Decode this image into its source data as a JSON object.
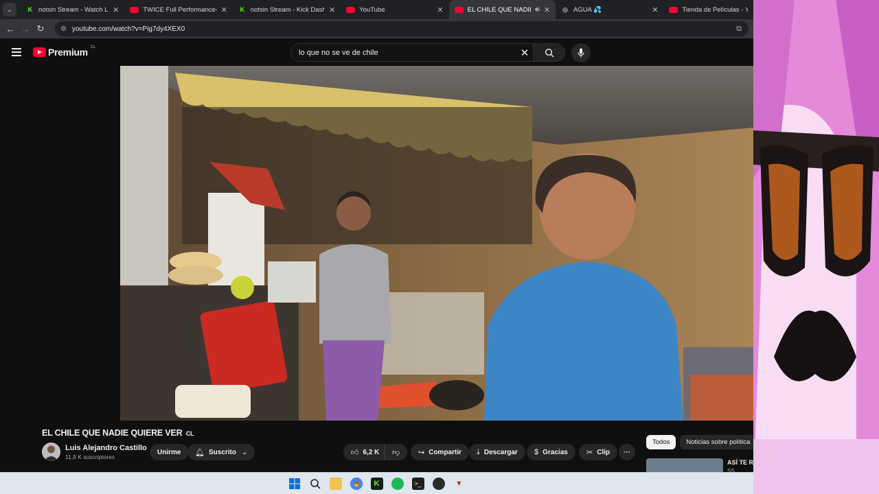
{
  "browser": {
    "tabs": [
      {
        "title": "notsin Stream - Watch Live on Kick",
        "icon": "kick-icon",
        "active": false
      },
      {
        "title": "TWICE Full Performance-Lollapalooza",
        "icon": "youtube-icon",
        "active": false
      },
      {
        "title": "notsin Stream - Kick Dashboard",
        "icon": "kick-icon",
        "active": false
      },
      {
        "title": "YouTube",
        "icon": "youtube-icon",
        "active": false
      },
      {
        "title": "EL CHILE QUE NADIE QUIERE VER",
        "icon": "youtube-icon",
        "active": true,
        "audio": true
      },
      {
        "title": "AGUA 💦",
        "icon": "web-icon",
        "active": false
      },
      {
        "title": "Tienda de Películas - YouTube",
        "icon": "youtube-icon",
        "active": false
      }
    ],
    "url": "youtube.com/watch?v=Pig7dy4XEX0"
  },
  "youtube": {
    "logo_text": "Premium",
    "country_code": "CL",
    "search_query": "lo que no se ve de chile"
  },
  "video": {
    "title": "EL CHILE QUE NADIE QUIERE VER",
    "title_suffix": "CL",
    "channel_name": "Luis Alejandro Castillo",
    "subscribers": "11,9 K suscriptores",
    "join_label": "Unirme",
    "subscribed_label": "Suscrito",
    "likes": "6,2 K",
    "share_label": "Compartir",
    "download_label": "Descargar",
    "thanks_label": "Gracias",
    "clip_label": "Clip",
    "more_label": "···"
  },
  "sidebar": {
    "chips": [
      "Todos",
      "Noticias sobre política"
    ],
    "rec_title": "ASÍ TE RO",
    "rec_sub": "SS"
  },
  "colors": {
    "bg": "#0f0f0f",
    "brand": "#ff0033",
    "overlay_hair": "#e58ad9"
  }
}
